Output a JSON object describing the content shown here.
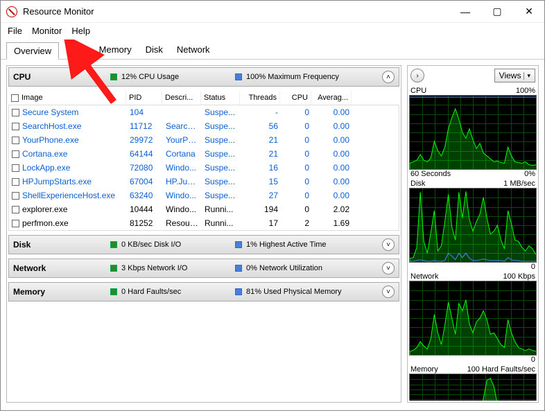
{
  "window": {
    "title": "Resource Monitor"
  },
  "menu": {
    "file": "File",
    "monitor": "Monitor",
    "help": "Help"
  },
  "tabs": {
    "overview": "Overview",
    "cpu": "CPU",
    "memory": "Memory",
    "disk": "Disk",
    "network": "Network"
  },
  "cpu_panel": {
    "title": "CPU",
    "stat1": "12% CPU Usage",
    "stat2": "100% Maximum Frequency",
    "columns": {
      "image": "Image",
      "pid": "PID",
      "desc": "Descri...",
      "status": "Status",
      "threads": "Threads",
      "cpu": "CPU",
      "avg": "Averag..."
    },
    "rows": [
      {
        "img": "Secure System",
        "pid": "104",
        "desc": "",
        "status": "Suspe...",
        "threads": "-",
        "cpu": "0",
        "avg": "0.00",
        "link": true
      },
      {
        "img": "SearchHost.exe",
        "pid": "11712",
        "desc": "Search...",
        "status": "Suspe...",
        "threads": "56",
        "cpu": "0",
        "avg": "0.00",
        "link": true
      },
      {
        "img": "YourPhone.exe",
        "pid": "29972",
        "desc": "YourPh...",
        "status": "Suspe...",
        "threads": "21",
        "cpu": "0",
        "avg": "0.00",
        "link": true
      },
      {
        "img": "Cortana.exe",
        "pid": "64144",
        "desc": "Cortana",
        "status": "Suspe...",
        "threads": "21",
        "cpu": "0",
        "avg": "0.00",
        "link": true
      },
      {
        "img": "LockApp.exe",
        "pid": "72080",
        "desc": "Windo...",
        "status": "Suspe...",
        "threads": "16",
        "cpu": "0",
        "avg": "0.00",
        "link": true
      },
      {
        "img": "HPJumpStarts.exe",
        "pid": "67004",
        "desc": "HP.Jum...",
        "status": "Suspe...",
        "threads": "15",
        "cpu": "0",
        "avg": "0.00",
        "link": true
      },
      {
        "img": "ShellExperienceHost.exe",
        "pid": "63240",
        "desc": "Windo...",
        "status": "Suspe...",
        "threads": "27",
        "cpu": "0",
        "avg": "0.00",
        "link": true
      },
      {
        "img": "explorer.exe",
        "pid": "10444",
        "desc": "Windo...",
        "status": "Runni...",
        "threads": "194",
        "cpu": "0",
        "avg": "2.02",
        "link": false
      },
      {
        "img": "perfmon.exe",
        "pid": "81252",
        "desc": "Resour...",
        "status": "Runni...",
        "threads": "17",
        "cpu": "2",
        "avg": "1.69",
        "link": false
      }
    ]
  },
  "disk_panel": {
    "title": "Disk",
    "stat1": "0 KB/sec Disk I/O",
    "stat2": "1% Highest Active Time"
  },
  "net_panel": {
    "title": "Network",
    "stat1": "3 Kbps Network I/O",
    "stat2": "0% Network Utilization"
  },
  "mem_panel": {
    "title": "Memory",
    "stat1": "0 Hard Faults/sec",
    "stat2": "81% Used Physical Memory"
  },
  "right": {
    "views": "Views",
    "cpu": {
      "title": "CPU",
      "right": "100%",
      "bl": "60 Seconds",
      "br": "0%"
    },
    "disk": {
      "title": "Disk",
      "right": "1 MB/sec",
      "br": "0"
    },
    "network": {
      "title": "Network",
      "right": "100 Kbps",
      "br": "0"
    },
    "memory": {
      "title": "Memory",
      "right": "100 Hard Faults/sec"
    }
  },
  "chart_data": [
    {
      "type": "area",
      "name": "CPU",
      "ylim": [
        0,
        100
      ],
      "xlabel": "60 Seconds",
      "values_pct": [
        8,
        10,
        12,
        20,
        12,
        10,
        15,
        38,
        25,
        18,
        30,
        55,
        70,
        82,
        68,
        50,
        42,
        55,
        40,
        28,
        35,
        22,
        18,
        14,
        10,
        11,
        9,
        8,
        30,
        18,
        10,
        9,
        8,
        10,
        6,
        5,
        6
      ],
      "overlay_line_pct": 98
    },
    {
      "type": "area",
      "name": "Disk",
      "ylim": [
        0,
        1
      ],
      "ylabel": "MB/sec",
      "values_pct": [
        5,
        6,
        20,
        95,
        28,
        12,
        40,
        70,
        15,
        22,
        55,
        92,
        48,
        30,
        95,
        60,
        96,
        58,
        42,
        55,
        65,
        88,
        60,
        38,
        42,
        50,
        30,
        18,
        70,
        52,
        30,
        28,
        20,
        15,
        22,
        18,
        10
      ],
      "overlay_line_values_pct": [
        1,
        1,
        2,
        3,
        2,
        1,
        1,
        2,
        1,
        1,
        2,
        12,
        8,
        3,
        12,
        6,
        12,
        5,
        2,
        2,
        3,
        4,
        3,
        2,
        2,
        2,
        2,
        1,
        6,
        3,
        2,
        2,
        1,
        1,
        1,
        1,
        1
      ]
    },
    {
      "type": "area",
      "name": "Network",
      "ylim": [
        0,
        100
      ],
      "ylabel": "Kbps",
      "values_pct": [
        5,
        6,
        10,
        18,
        12,
        8,
        22,
        55,
        30,
        14,
        40,
        72,
        50,
        28,
        70,
        60,
        75,
        42,
        30,
        45,
        50,
        60,
        48,
        28,
        30,
        22,
        14,
        10,
        48,
        30,
        18,
        10,
        8,
        6,
        8,
        6,
        5
      ]
    },
    {
      "type": "area",
      "name": "Memory",
      "ylim": [
        0,
        100
      ],
      "ylabel": "Hard Faults/sec",
      "values_pct": [
        0,
        2,
        2,
        12,
        0,
        0,
        0,
        0,
        1,
        0,
        2,
        0,
        0,
        6,
        0,
        0,
        0,
        0,
        0,
        0,
        1,
        40,
        85,
        90,
        70,
        25,
        8,
        4,
        15,
        0,
        0,
        0,
        2,
        1,
        0,
        0,
        0
      ],
      "overlay_line_pct": 81
    }
  ]
}
